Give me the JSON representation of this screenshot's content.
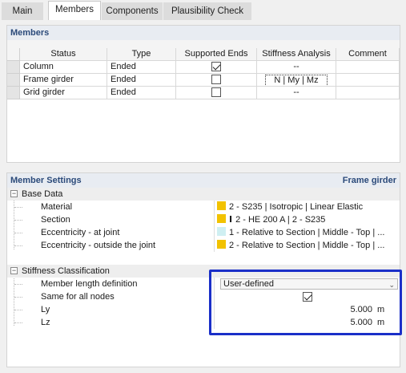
{
  "tabs": [
    {
      "label": "Main"
    },
    {
      "label": "Members"
    },
    {
      "label": "Components"
    },
    {
      "label": "Plausibility Check"
    }
  ],
  "members_panel": {
    "title": "Members",
    "columns": [
      "Status",
      "Type",
      "Supported Ends",
      "Stiffness Analysis",
      "Comment"
    ],
    "rows": [
      {
        "status": "Column",
        "type": "Ended",
        "supported": true,
        "stiffness": "--",
        "comment": ""
      },
      {
        "status": "Frame girder",
        "type": "Ended",
        "supported": false,
        "stiffness": "N | My | Mz",
        "comment": ""
      },
      {
        "status": "Grid girder",
        "type": "Ended",
        "supported": false,
        "stiffness": "--",
        "comment": ""
      }
    ]
  },
  "settings_panel": {
    "title": "Member Settings",
    "context": "Frame girder",
    "base_data": {
      "label": "Base Data",
      "items": [
        {
          "label": "Material",
          "value": "2 - S235 | Isotropic | Linear Elastic",
          "color": "#f2c200"
        },
        {
          "label": "Section",
          "value": "2 - HE 200 A | 2 - S235",
          "color": "#f2c200",
          "icon": "i-beam-icon"
        },
        {
          "label": "Eccentricity - at joint",
          "value": "1 - Relative to Section | Middle - Top | ...",
          "color": "#cfeff2"
        },
        {
          "label": "Eccentricity - outside the joint",
          "value": "2 - Relative to Section | Middle - Top | ...",
          "color": "#f2c200"
        }
      ]
    },
    "stiffness": {
      "label": "Stiffness Classification",
      "member_length_label": "Member length definition",
      "member_length_value": "User-defined",
      "same_nodes_label": "Same for all nodes",
      "same_nodes_checked": true,
      "ly_label": "Ly",
      "ly_value": "5.000",
      "ly_unit": "m",
      "lz_label": "Lz",
      "lz_value": "5.000",
      "lz_unit": "m"
    }
  },
  "colors": {
    "highlight": "#1a2fc8",
    "header_text": "#2b4a7a"
  }
}
